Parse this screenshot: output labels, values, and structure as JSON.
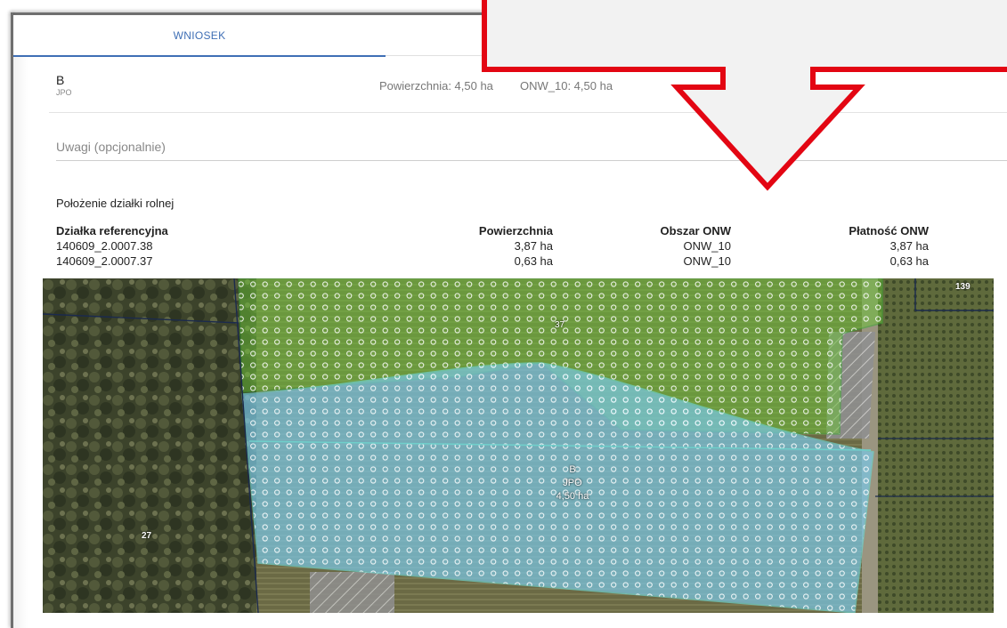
{
  "tabs": [
    {
      "label": "WNIOSEK",
      "active": true
    }
  ],
  "plot": {
    "name": "B",
    "type": "JPO",
    "area_text": "Powierzchnia: 4,50 ha",
    "onw_text": "ONW_10: 4,50 ha"
  },
  "remarks": {
    "placeholder": "Uwagi (opcjonalnie)"
  },
  "location": {
    "title": "Położenie działki rolnej",
    "columns": [
      "Działka referencyjna",
      "Powierzchnia",
      "Obszar ONW",
      "Płatność ONW"
    ],
    "rows": [
      {
        "ref": "140609_2.0007.38",
        "area": "3,87 ha",
        "onw": "ONW_10",
        "payment": "3,87 ha"
      },
      {
        "ref": "140609_2.0007.37",
        "area": "0,63 ha",
        "onw": "ONW_10",
        "payment": "0,63 ha"
      }
    ]
  },
  "map": {
    "parcel_labels": [
      "37",
      "139",
      "27"
    ],
    "plot_label": [
      "B",
      "JPO",
      "4,50 ha"
    ]
  },
  "colors": {
    "accent": "#3f6fb5",
    "callout_red": "#e30613",
    "parcel_green": "#6cbf3a",
    "plot_blue": "#7ac8e8"
  }
}
